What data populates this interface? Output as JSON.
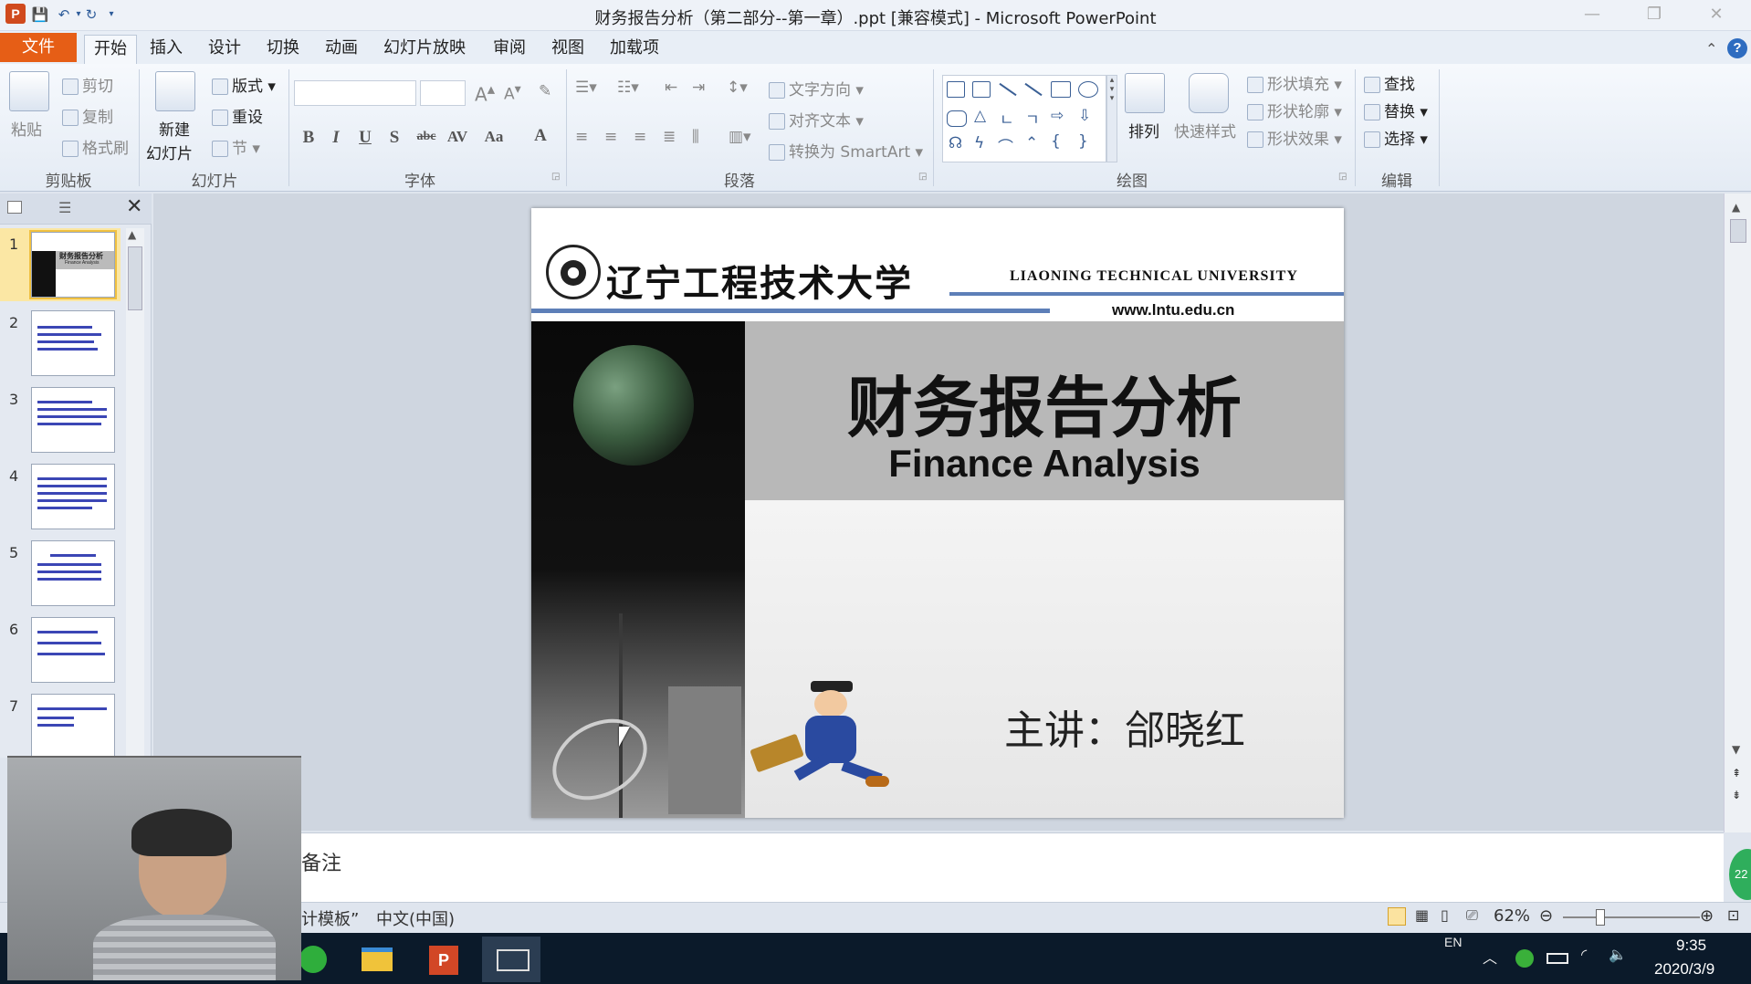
{
  "window": {
    "title": "财务报告分析（第二部分--第一章）.ppt [兼容模式] - Microsoft PowerPoint",
    "app_icon": "P"
  },
  "ribbon": {
    "file_tab": "文件",
    "tabs": [
      "开始",
      "插入",
      "设计",
      "切换",
      "动画",
      "幻灯片放映",
      "审阅",
      "视图",
      "加载项"
    ],
    "clipboard": {
      "paste": "粘贴",
      "cut": "剪切",
      "copy": "复制",
      "format_painter": "格式刷",
      "label": "剪贴板"
    },
    "slides": {
      "new_slide": "新建",
      "new_slide2": "幻灯片",
      "layout": "版式",
      "reset": "重设",
      "section": "节",
      "label": "幻灯片"
    },
    "font": {
      "label": "字体",
      "bold": "B",
      "italic": "I",
      "underline": "U",
      "shadow": "S",
      "strike": "abc",
      "spacing": "AV",
      "case": "Aa",
      "color": "A"
    },
    "paragraph": {
      "label": "段落",
      "text_direction": "文字方向",
      "align_text": "对齐文本",
      "smartart": "转换为 SmartArt"
    },
    "drawing": {
      "label": "绘图",
      "arrange": "排列",
      "quick_styles": "快速样式",
      "shape_fill": "形状填充",
      "shape_outline": "形状轮廓",
      "shape_effects": "形状效果"
    },
    "editing": {
      "label": "编辑",
      "find": "查找",
      "replace": "替换",
      "select": "选择"
    }
  },
  "thumbnails": {
    "numbers": [
      "1",
      "2",
      "3",
      "4",
      "5",
      "6",
      "7"
    ],
    "first_title": "财务报告分析",
    "first_sub": "Finance Analysis"
  },
  "slide": {
    "university_cn": "辽宁工程技术大学",
    "university_en": "LIAONING TECHNICAL UNIVERSITY",
    "url": "www.lntu.edu.cn",
    "title_cn": "财务报告分析",
    "title_en": "Finance Analysis",
    "presenter": "主讲：郃晓红"
  },
  "notes": {
    "label": "备注"
  },
  "status": {
    "template": "计模板”",
    "language": "中文(中国)",
    "zoom": "62%"
  },
  "taskbar": {
    "lang": "EN",
    "time": "9:35",
    "date": "2020/3/9",
    "badge": "22"
  },
  "colors": {
    "file_tab": "#e65e16",
    "accent": "#2e5c9a",
    "slide_gray": "#b8b8b8",
    "thumb_text": "#3b46b5"
  }
}
